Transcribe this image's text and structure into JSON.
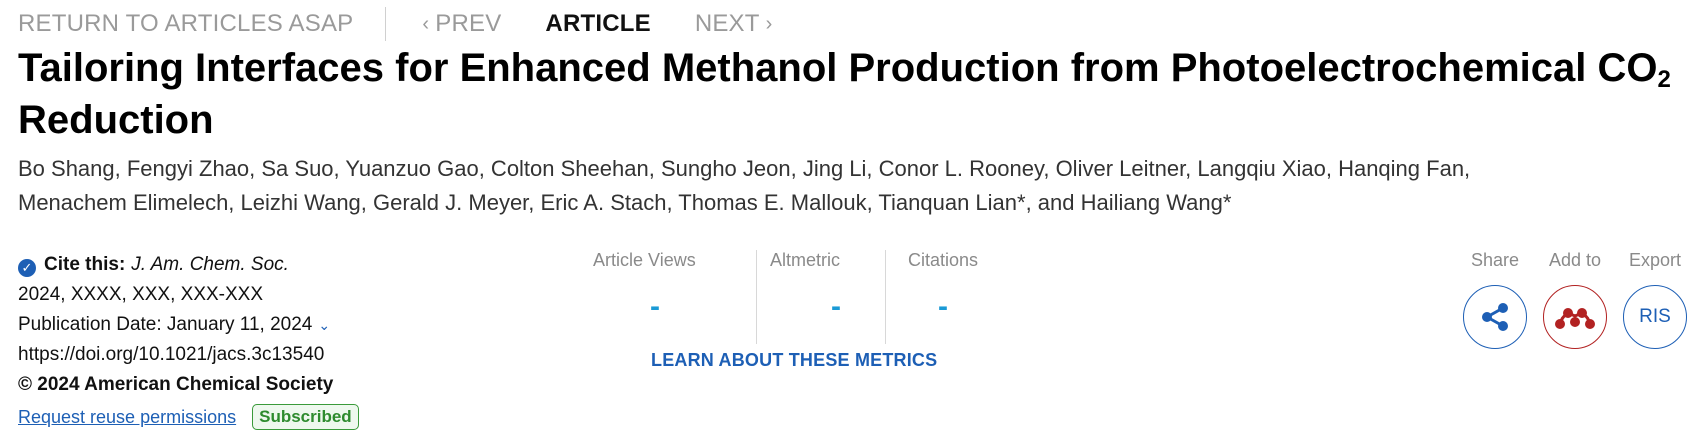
{
  "nav": {
    "return_label": "RETURN TO ARTICLES ASAP",
    "prev_label": "PREV",
    "current_label": "ARTICLE",
    "next_label": "NEXT"
  },
  "article": {
    "title_main": "Tailoring Interfaces for Enhanced Methanol Production from Photoelectrochemical CO",
    "title_sub": "2",
    "title_end": "Reduction",
    "authors_line1": "Bo Shang, Fengyi Zhao, Sa Suo, Yuanzuo Gao, Colton Sheehan, Sungho Jeon, Jing Li, Conor L. Rooney, Oliver Leitner, Langqiu Xiao, Hanqing Fan,",
    "authors_line2": "Menachem Elimelech, Leizhi Wang, Gerald J. Meyer, Eric A. Stach, Thomas E. Mallouk, Tianquan Lian*, and Hailiang Wang*"
  },
  "citation": {
    "label": "Cite this:",
    "journal": "J. Am. Chem. Soc.",
    "details": "2024, XXXX, XXX, XXX-XXX",
    "publication_date": "Publication Date: January 11, 2024",
    "doi": "https://doi.org/10.1021/jacs.3c13540",
    "copyright": "© 2024 American Chemical Society",
    "reuse_link": "Request reuse permissions",
    "badge": "Subscribed"
  },
  "metrics": {
    "views_label": "Article Views",
    "views_value": "-",
    "altmetric_label": "Altmetric",
    "altmetric_value": "-",
    "citations_label": "Citations",
    "citations_value": "-",
    "learn_link": "LEARN ABOUT THESE METRICS"
  },
  "actions": {
    "share_label": "Share",
    "add_label": "Add to",
    "export_label": "Export",
    "ris_label": "RIS",
    "share_icon": "share-icon",
    "add_icon": "mendeley-icon"
  },
  "colors": {
    "link_blue": "#1d5fb5",
    "metric_blue": "#1a9ad6",
    "mendeley_red": "#b22222",
    "subscribed_green": "#2e8b2e"
  }
}
